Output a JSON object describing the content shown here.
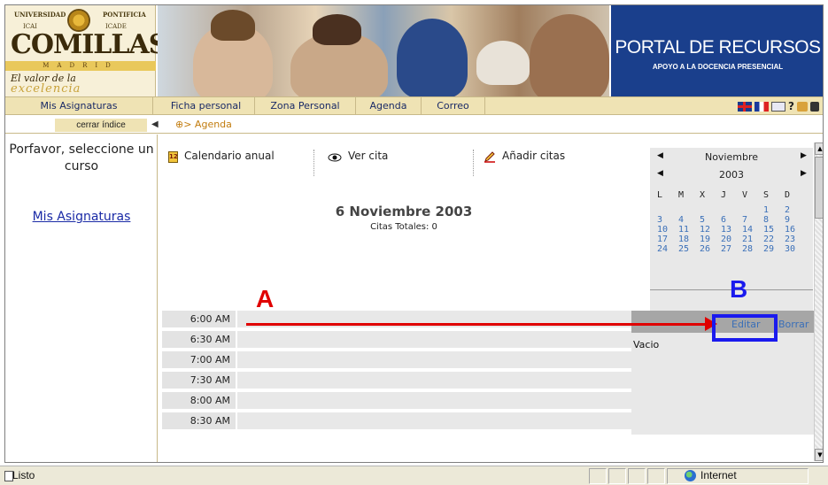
{
  "banner": {
    "logo_universidad": "UNIVERSIDAD",
    "logo_pontificia": "PONTIFICIA",
    "logo_icai": "ICAI",
    "logo_icade": "ICADE",
    "logo_name": "COMILLAS",
    "logo_city": "MADRID",
    "logo_motto_1": "El valor de la",
    "logo_motto_2": "excelencia",
    "portal_title": "PORTAL DE RECURSOS",
    "portal_subtitle": "APOYO A LA DOCENCIA PRESENCIAL"
  },
  "nav": {
    "items": [
      {
        "label": "Mis Asignaturas"
      },
      {
        "label": "Ficha personal"
      },
      {
        "label": "Zona Personal"
      },
      {
        "label": "Agenda"
      },
      {
        "label": "Correo"
      }
    ],
    "help": "?"
  },
  "bar2": {
    "cerrar": "cerrar índice",
    "breadcrumb": "> Agenda"
  },
  "left": {
    "message": "Porfavor, seleccione un curso",
    "link": "Mis Asignaturas"
  },
  "toolbar": {
    "calendario": "Calendario anual",
    "ver_cita": "Ver cita",
    "anadir": "Añadir citas",
    "cal_icon_text": "12"
  },
  "main": {
    "date_title": "6 Noviembre 2003",
    "citas_totales": "Citas Totales: 0"
  },
  "calendar": {
    "month": "Noviembre",
    "year": "2003",
    "dow": [
      "L",
      "M",
      "X",
      "J",
      "V",
      "S",
      "D"
    ],
    "weeks": [
      [
        "",
        "",
        "",
        "",
        "",
        "1",
        "2"
      ],
      [
        "3",
        "4",
        "5",
        "6",
        "7",
        "8",
        "9"
      ],
      [
        "10",
        "11",
        "12",
        "13",
        "14",
        "15",
        "16"
      ],
      [
        "17",
        "18",
        "19",
        "20",
        "21",
        "22",
        "23"
      ],
      [
        "24",
        "25",
        "26",
        "27",
        "28",
        "29",
        "30"
      ]
    ]
  },
  "timeslots": [
    "6:00 AM",
    "6:30 AM",
    "7:00 AM",
    "7:30 AM",
    "8:00 AM",
    "8:30 AM"
  ],
  "detail": {
    "editar": "Editar",
    "borrar": "Borrar",
    "vacio": "Vacio"
  },
  "annotations": {
    "a": "A",
    "b": "B",
    "arrow_color": "#e00000",
    "box_color": "#1a1aee"
  },
  "status": {
    "text": "Listo",
    "zone": "Internet"
  },
  "colors": {
    "nav_bg": "#efe3b4",
    "portal_bg": "#1a3f8c",
    "link": "#3a6fb8",
    "breadcrumb": "#c27c0e"
  }
}
